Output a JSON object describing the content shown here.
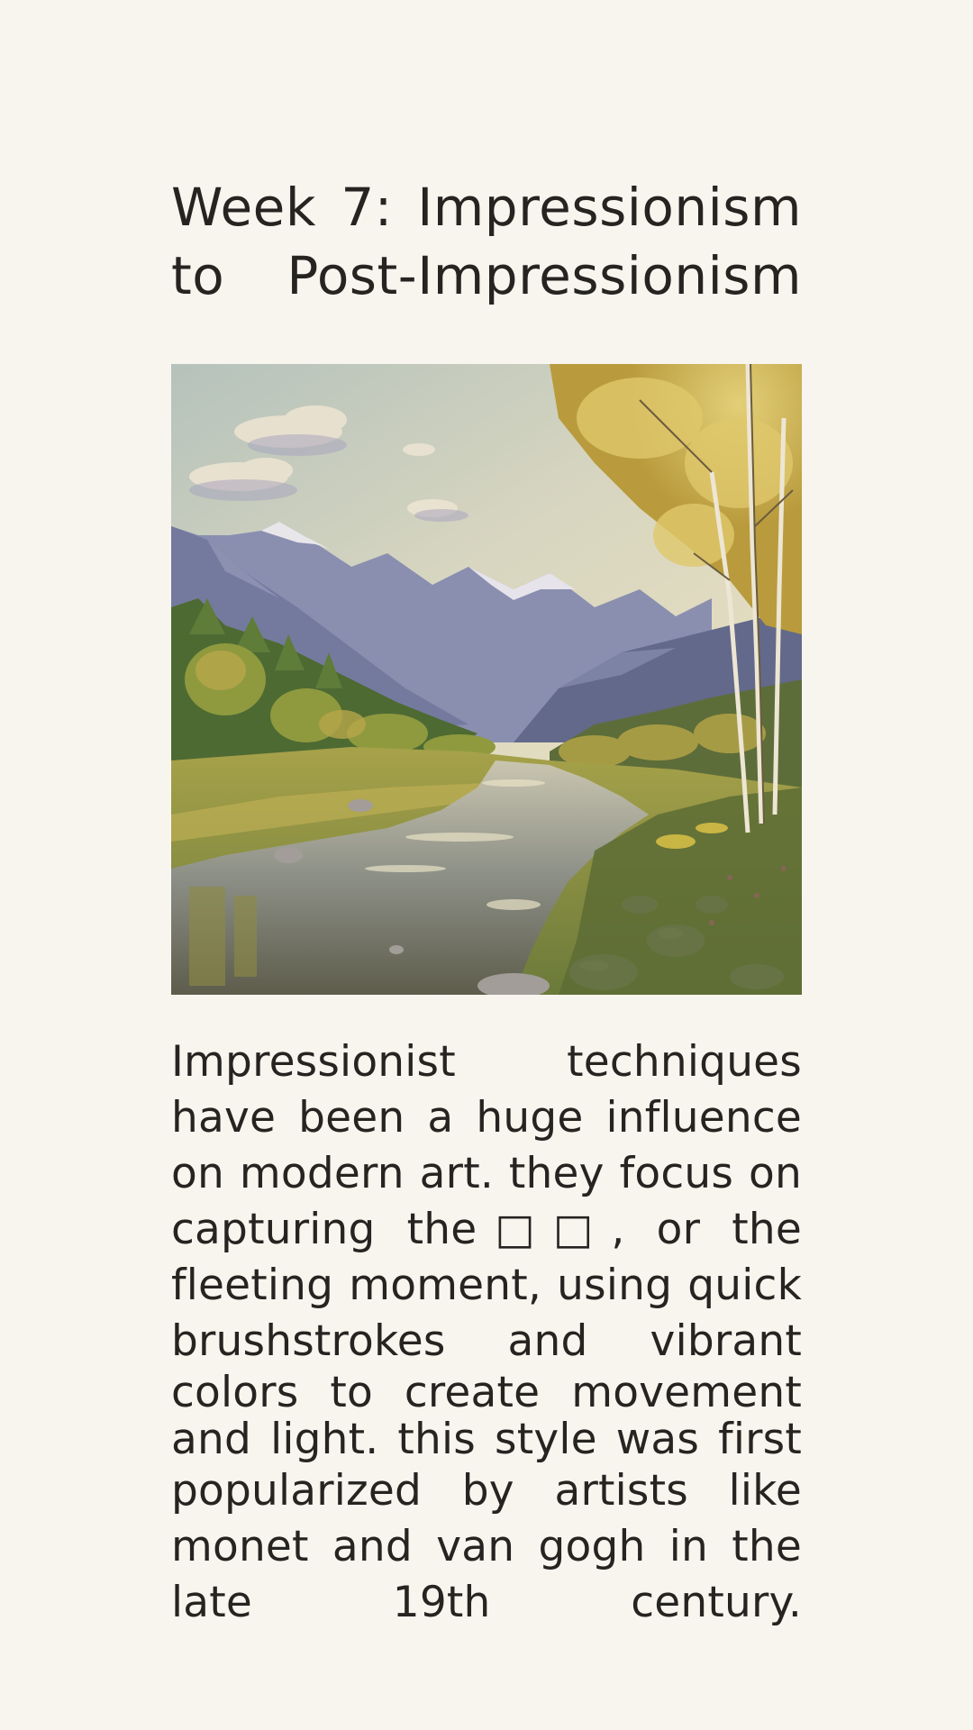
{
  "title": {
    "line1": "Week 7: Impressionism",
    "line2": "to Post-Impressionism"
  },
  "image": {
    "icon": "landscape-painting-icon",
    "subject": "mountain-valley-river-autumn-painting"
  },
  "body": {
    "lines": [
      "Impressionist techniques",
      "have been a huge influence",
      "on modern art. they focus on",
      "capturing the□□, or the",
      "fleeting moment, using quick",
      "brushstrokes and vibrant",
      "colors to create movement",
      "and light. this style was first",
      "popularized by artists like",
      "monet and van gogh in the",
      "late 19th century."
    ]
  },
  "colors": {
    "background": "#f8f5ef",
    "text": "#262421"
  }
}
